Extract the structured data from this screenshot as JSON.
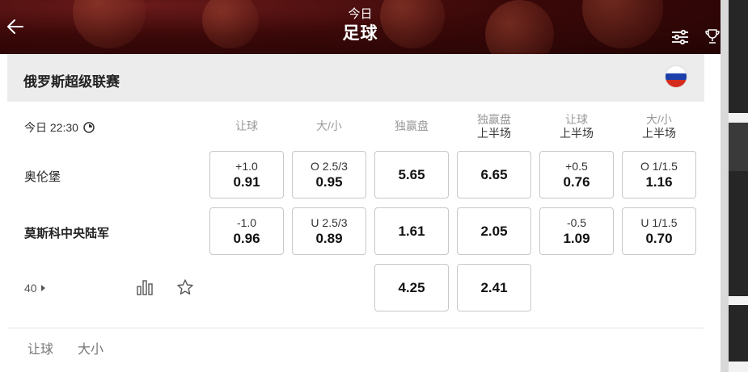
{
  "header": {
    "subtitle": "今日",
    "title": "足球"
  },
  "league": {
    "name": "俄罗斯超级联赛",
    "flag_colors": [
      "#ffffff",
      "#1c3faa",
      "#d52b1e"
    ]
  },
  "match": {
    "time": "今日 22:30",
    "home": "奥伦堡",
    "away": "莫斯科中央陆军",
    "more_count": "40"
  },
  "columns": [
    {
      "line1": "让球",
      "line2": ""
    },
    {
      "line1": "大/小",
      "line2": ""
    },
    {
      "line1": "独赢盘",
      "line2": ""
    },
    {
      "line1": "独赢盘",
      "line2": "上半场"
    },
    {
      "line1": "让球",
      "line2": "上半场"
    },
    {
      "line1": "大/小",
      "line2": "上半场"
    }
  ],
  "odds": {
    "home": [
      {
        "line": "+1.0",
        "price": "0.91"
      },
      {
        "line": "O 2.5/3",
        "price": "0.95"
      },
      {
        "line": "",
        "price": "5.65"
      },
      {
        "line": "",
        "price": "6.65"
      },
      {
        "line": "+0.5",
        "price": "0.76"
      },
      {
        "line": "O 1/1.5",
        "price": "1.16"
      }
    ],
    "away": [
      {
        "line": "-1.0",
        "price": "0.96"
      },
      {
        "line": "U 2.5/3",
        "price": "0.89"
      },
      {
        "line": "",
        "price": "1.61"
      },
      {
        "line": "",
        "price": "2.05"
      },
      {
        "line": "-0.5",
        "price": "1.09"
      },
      {
        "line": "U 1/1.5",
        "price": "0.70"
      }
    ],
    "draw": [
      {
        "price": "4.25"
      },
      {
        "price": "2.41"
      }
    ]
  },
  "bottom_tabs": [
    "让球",
    "大小"
  ],
  "icons": {
    "back": "arrow-left-icon",
    "filter": "sliders-icon",
    "trophy": "trophy-icon",
    "clock": "clock-icon",
    "stats": "bar-chart-icon",
    "favorite": "star-icon"
  }
}
